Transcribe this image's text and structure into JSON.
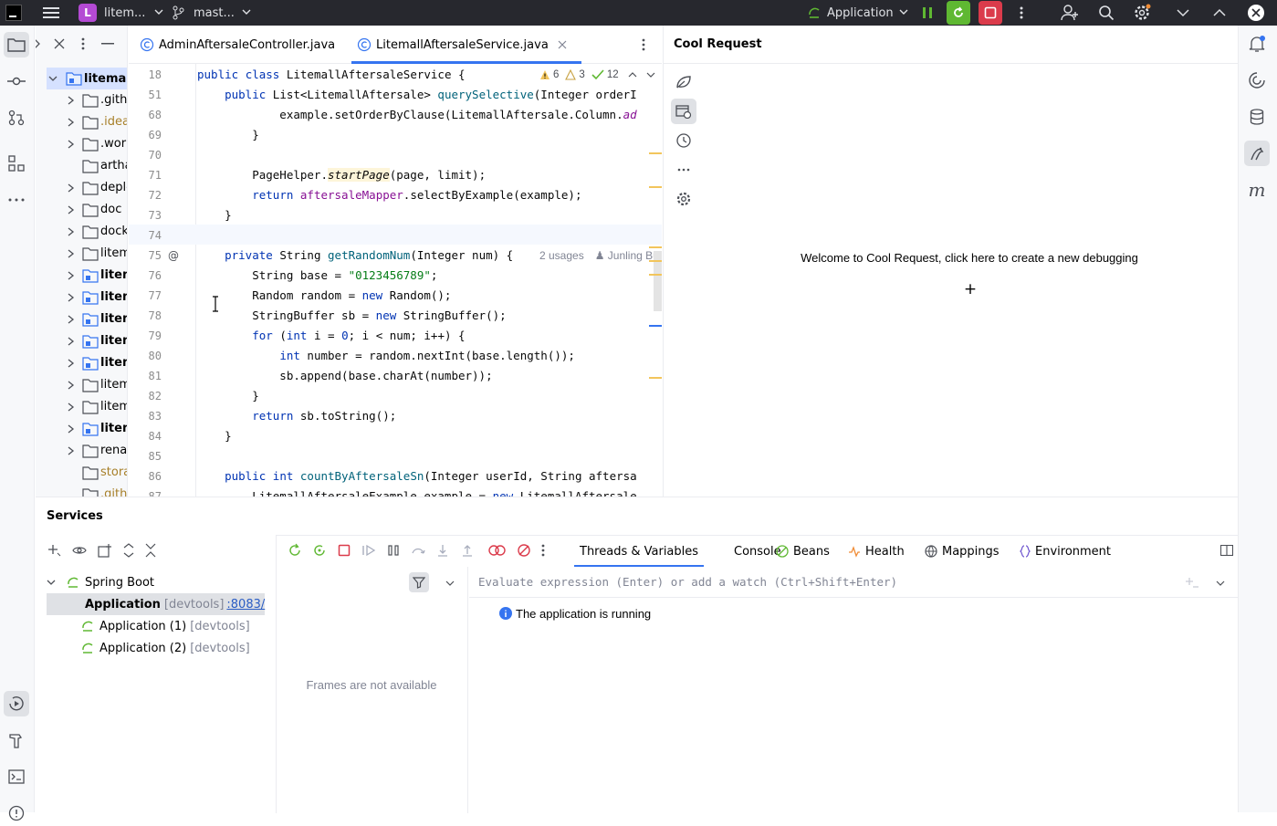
{
  "titlebar": {
    "project_badge": "L",
    "project_name": "litem...",
    "branch": "mast...",
    "run_config": "Application"
  },
  "project_tree": {
    "root": "litemall",
    "items": [
      {
        "label": ".githu",
        "bold": false,
        "expandable": true,
        "muted": false
      },
      {
        "label": ".idea",
        "bold": false,
        "expandable": true,
        "muted": true
      },
      {
        "label": ".work",
        "bold": false,
        "expandable": true,
        "muted": false
      },
      {
        "label": "artha",
        "bold": false,
        "expandable": false,
        "muted": false
      },
      {
        "label": "deplo",
        "bold": false,
        "expandable": true,
        "muted": false
      },
      {
        "label": "doc",
        "bold": false,
        "expandable": true,
        "muted": false
      },
      {
        "label": "dock",
        "bold": false,
        "expandable": true,
        "muted": false
      },
      {
        "label": "litem",
        "bold": false,
        "expandable": true,
        "muted": false
      },
      {
        "label": "litem",
        "bold": true,
        "expandable": true,
        "muted": false
      },
      {
        "label": "litem",
        "bold": true,
        "expandable": true,
        "muted": false
      },
      {
        "label": "litem",
        "bold": true,
        "expandable": true,
        "muted": false
      },
      {
        "label": "litem",
        "bold": true,
        "expandable": true,
        "muted": false
      },
      {
        "label": "litem",
        "bold": true,
        "expandable": true,
        "muted": false
      },
      {
        "label": "litem",
        "bold": false,
        "expandable": true,
        "muted": false
      },
      {
        "label": "litem",
        "bold": false,
        "expandable": true,
        "muted": false
      },
      {
        "label": "litem",
        "bold": true,
        "expandable": true,
        "muted": false
      },
      {
        "label": "renar",
        "bold": false,
        "expandable": true,
        "muted": false
      },
      {
        "label": "stora",
        "bold": false,
        "expandable": false,
        "muted": true
      },
      {
        "label": ".githu",
        "bold": false,
        "expandable": false,
        "muted": true
      }
    ]
  },
  "editor": {
    "tabs": [
      {
        "label": "AdminAftersaleController.java",
        "active": false
      },
      {
        "label": "LitemallAftersaleService.java",
        "active": true
      }
    ],
    "inspections": {
      "warnings": "6",
      "weak_warnings": "3",
      "ok": "12"
    },
    "lines": [
      {
        "num": "18",
        "code": "public class LitemallAftersaleService {"
      },
      {
        "num": "51",
        "code": "    public List<LitemallAftersale> querySelective(Integer orderI"
      },
      {
        "num": "68",
        "code": "            example.setOrderByClause(LitemallAftersale.Column.ad"
      },
      {
        "num": "69",
        "code": "        }"
      },
      {
        "num": "70",
        "code": ""
      },
      {
        "num": "71",
        "code": "        PageHelper.startPage(page, limit);"
      },
      {
        "num": "72",
        "code": "        return aftersaleMapper.selectByExample(example);"
      },
      {
        "num": "73",
        "code": "    }"
      },
      {
        "num": "74",
        "code": ""
      },
      {
        "num": "75",
        "code": "    private String getRandomNum(Integer num) {"
      },
      {
        "num": "76",
        "code": "        String base = \"0123456789\";"
      },
      {
        "num": "77",
        "code": "        Random random = new Random();"
      },
      {
        "num": "78",
        "code": "        StringBuffer sb = new StringBuffer();"
      },
      {
        "num": "79",
        "code": "        for (int i = 0; i < num; i++) {"
      },
      {
        "num": "80",
        "code": "            int number = random.nextInt(base.length());"
      },
      {
        "num": "81",
        "code": "            sb.append(base.charAt(number));"
      },
      {
        "num": "82",
        "code": "        }"
      },
      {
        "num": "83",
        "code": "        return sb.toString();"
      },
      {
        "num": "84",
        "code": "    }"
      },
      {
        "num": "85",
        "code": ""
      },
      {
        "num": "86",
        "code": "    public int countByAftersaleSn(Integer userId, String aftersa"
      },
      {
        "num": "87",
        "code": "        LitemallAftersaleExample example = new LitemallAftersale"
      }
    ],
    "usages_hint": "2 usages",
    "author_hint": "Junling Bu"
  },
  "cool_request": {
    "title": "Cool Request",
    "welcome": "Welcome to Cool Request, click here to create a new debugging",
    "plus": "+"
  },
  "services": {
    "title": "Services",
    "tree": {
      "group": "Spring Boot",
      "apps": [
        {
          "name": "Application",
          "suffix": "[devtools]",
          "link": ":8083/",
          "selected": true
        },
        {
          "name": "Application (1)",
          "suffix": "[devtools]",
          "link": "",
          "selected": false
        },
        {
          "name": "Application (2)",
          "suffix": "[devtools]",
          "link": "",
          "selected": false
        }
      ]
    },
    "tabs": [
      "Threads & Variables",
      "Console",
      "Beans",
      "Health",
      "Mappings",
      "Environment"
    ],
    "frames_empty": "Frames are not available",
    "evaluate_placeholder": "Evaluate expression (Enter) or add a watch (Ctrl+Shift+Enter)",
    "status": "The application is running"
  }
}
